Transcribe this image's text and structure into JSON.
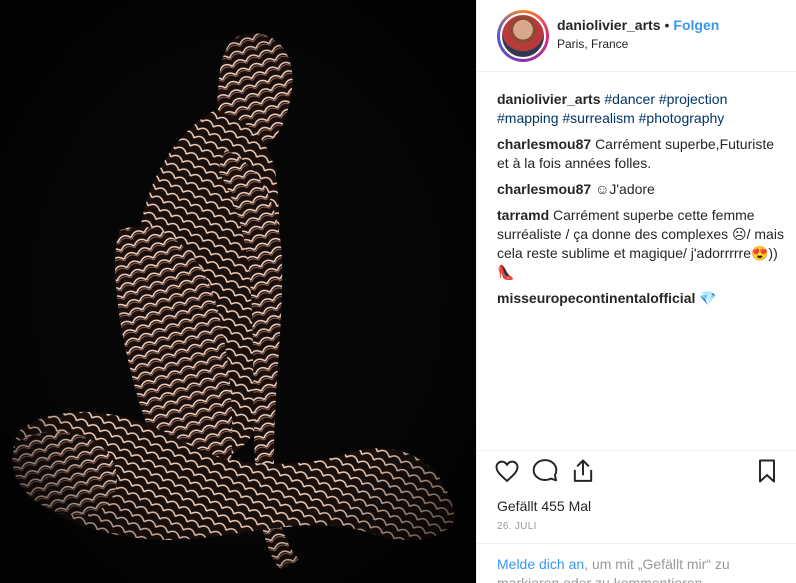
{
  "header": {
    "username": "daniolivier_arts",
    "separator": "•",
    "follow_label": "Folgen",
    "location": "Paris, France"
  },
  "caption": {
    "username": "daniolivier_arts",
    "tags": [
      "#dancer",
      "#projection",
      "#mapping",
      "#surrealism",
      "#photography"
    ]
  },
  "comments": [
    {
      "username": "charlesmou87",
      "text": "Carrément superbe,Futuriste et à la fois années folles."
    },
    {
      "username": "charlesmou87",
      "text": "☺J'adore"
    },
    {
      "username": "tarramd",
      "text": "Carrément superbe cette femme surréaliste / ça donne des complexes ☹/ mais cela reste sublime et magique/ j'adorrrrre😍)) 👠"
    },
    {
      "username": "misseuropecontinentalofficial",
      "text": "💎"
    }
  ],
  "actions": {
    "like_icon": "heart-icon",
    "comment_icon": "comment-icon",
    "share_icon": "share-icon",
    "save_icon": "bookmark-icon"
  },
  "likes_text": "Gefällt 455 Mal",
  "date": "26. JULI",
  "login_prompt": {
    "link": "Melde dich an",
    "text": ", um mit „Gefällt mir“ zu markieren oder zu kommentieren."
  },
  "colors": {
    "link_blue": "#3897f0",
    "hashtag_blue": "#003569",
    "text": "#262626",
    "muted": "#999999"
  }
}
